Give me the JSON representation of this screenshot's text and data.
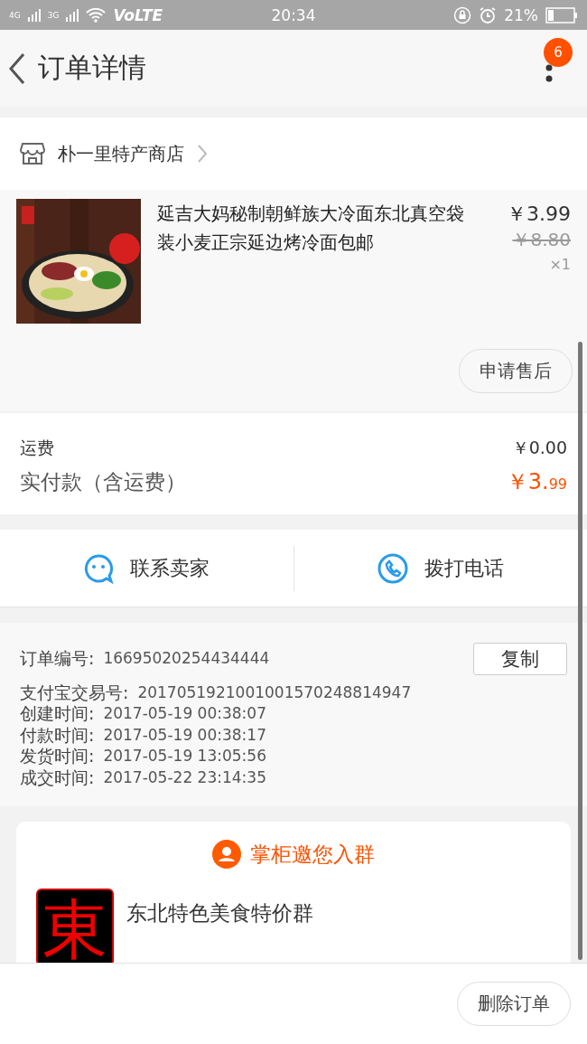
{
  "status_bar": {
    "network_1": "4G",
    "network_2": "3G",
    "volte": "VoLTE",
    "time": "20:34",
    "battery": "21%"
  },
  "nav": {
    "title": "订单详情",
    "badge": "6"
  },
  "shop": {
    "name": "朴一里特产商店"
  },
  "product": {
    "title": "延吉大妈秘制朝鲜族大冷面东北真空袋装小麦正宗延边烤冷面包邮",
    "price": "￥3.99",
    "original_price": "￥8.80",
    "quantity": "×1",
    "after_sale_button": "申请售后"
  },
  "fees": [
    {
      "label": "运费",
      "value": "￥0.00",
      "kind": "plain"
    },
    {
      "label": "实付款（含运费）",
      "value_main": "￥3.",
      "value_small": "99",
      "kind": "total"
    }
  ],
  "actions": [
    {
      "label": "联系卖家",
      "kind": "chat"
    },
    {
      "label": "拨打电话",
      "kind": "phone"
    }
  ],
  "order_info": {
    "copy_button": "复制",
    "rows": [
      {
        "label": "订单编号:",
        "value": "16695020254434444"
      },
      {
        "label": "支付宝交易号:",
        "value": "2017051921001001570248814947"
      },
      {
        "label": "创建时间:",
        "value": "2017-05-19 00:38:07"
      },
      {
        "label": "付款时间:",
        "value": "2017-05-19 00:38:17"
      },
      {
        "label": "发货时间:",
        "value": "2017-05-19 13:05:56"
      },
      {
        "label": "成交时间:",
        "value": "2017-05-22 23:14:35"
      }
    ]
  },
  "group": {
    "heading": "掌柜邀您入群",
    "avatar_text": "東",
    "name": "东北特色美食特价群"
  },
  "bottom_bar": {
    "button": "删除订单"
  }
}
